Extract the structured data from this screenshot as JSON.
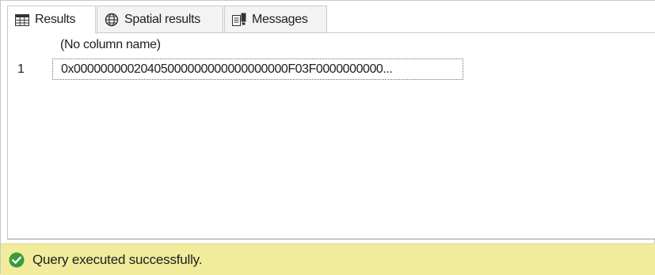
{
  "tabs": [
    {
      "label": "Results",
      "icon": "grid-icon",
      "active": true
    },
    {
      "label": "Spatial results",
      "icon": "globe-icon",
      "active": false
    },
    {
      "label": "Messages",
      "icon": "messages-icon",
      "active": false
    }
  ],
  "results": {
    "columns": [
      "(No column name)"
    ],
    "rows": [
      {
        "number": "1",
        "cells": [
          "0x00000000020405000000000000000000F03F0000000000..."
        ]
      }
    ]
  },
  "status": {
    "text": "Query executed successfully.",
    "icon": "check-circle-icon",
    "icon_color": "#3a9b3a",
    "background": "#f0ec9c"
  }
}
